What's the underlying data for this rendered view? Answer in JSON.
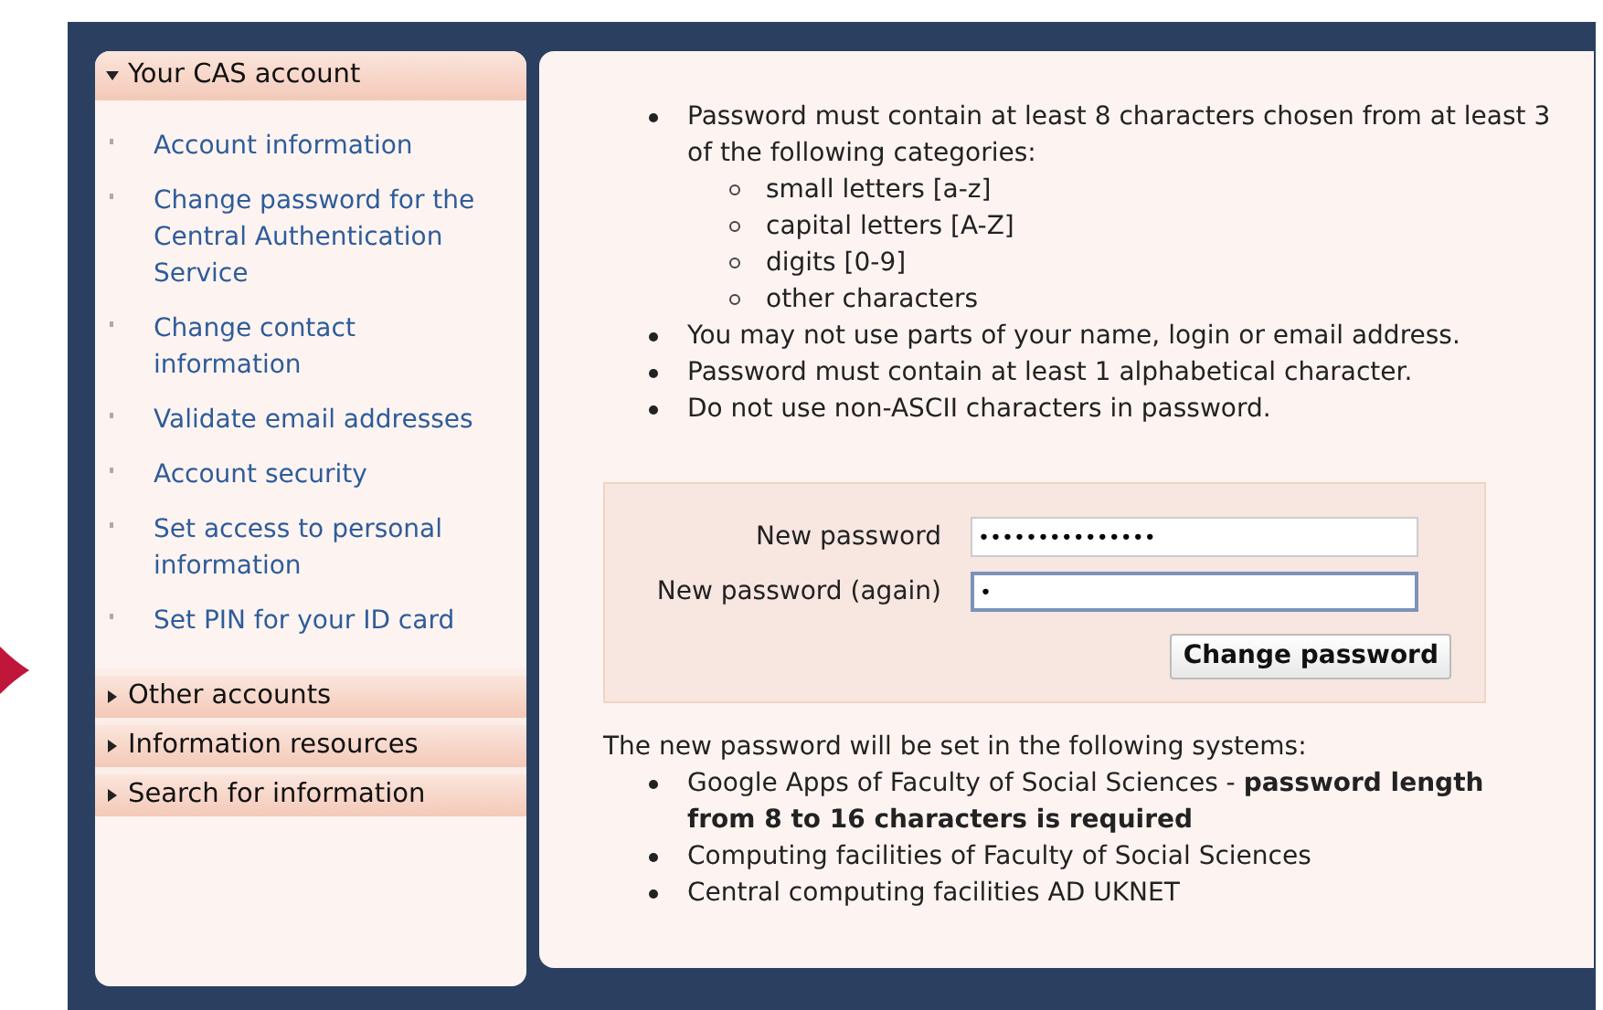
{
  "sidebar": {
    "sections": [
      {
        "title": "Your CAS account",
        "expanded": true,
        "items": [
          "Account information",
          "Change password for the Central Authentication Service",
          "Change contact information",
          "Validate email addresses",
          "Account security",
          "Set access to personal information",
          "Set PIN for your ID card"
        ]
      },
      {
        "title": "Other accounts",
        "expanded": false
      },
      {
        "title": "Information resources",
        "expanded": false
      },
      {
        "title": "Search for information",
        "expanded": false
      }
    ]
  },
  "policy": {
    "rules": [
      {
        "text": "Password must contain at least 8 characters chosen from at least 3 of the following categories:",
        "children": [
          "small letters [a-z]",
          "capital letters [A-Z]",
          "digits [0-9]",
          "other characters"
        ]
      },
      {
        "text": "You may not use parts of your name, login or email address."
      },
      {
        "text": "Password must contain at least 1 alphabetical character."
      },
      {
        "text": "Do not use non-ASCII characters in password."
      }
    ]
  },
  "form": {
    "fields": [
      {
        "label": "New password",
        "value": "•••••••••••••••",
        "focused": false
      },
      {
        "label": "New password (again)",
        "value": "•",
        "focused": true
      }
    ],
    "submit": "Change password"
  },
  "systems": {
    "intro": "The new password will be set in the following systems:",
    "items": [
      "Google Apps of Faculty of Social Sciences - **password length from 8 to 16 characters is required**",
      "Computing facilities of Faculty of Social Sciences",
      "Central computing facilities AD UKNET"
    ]
  }
}
